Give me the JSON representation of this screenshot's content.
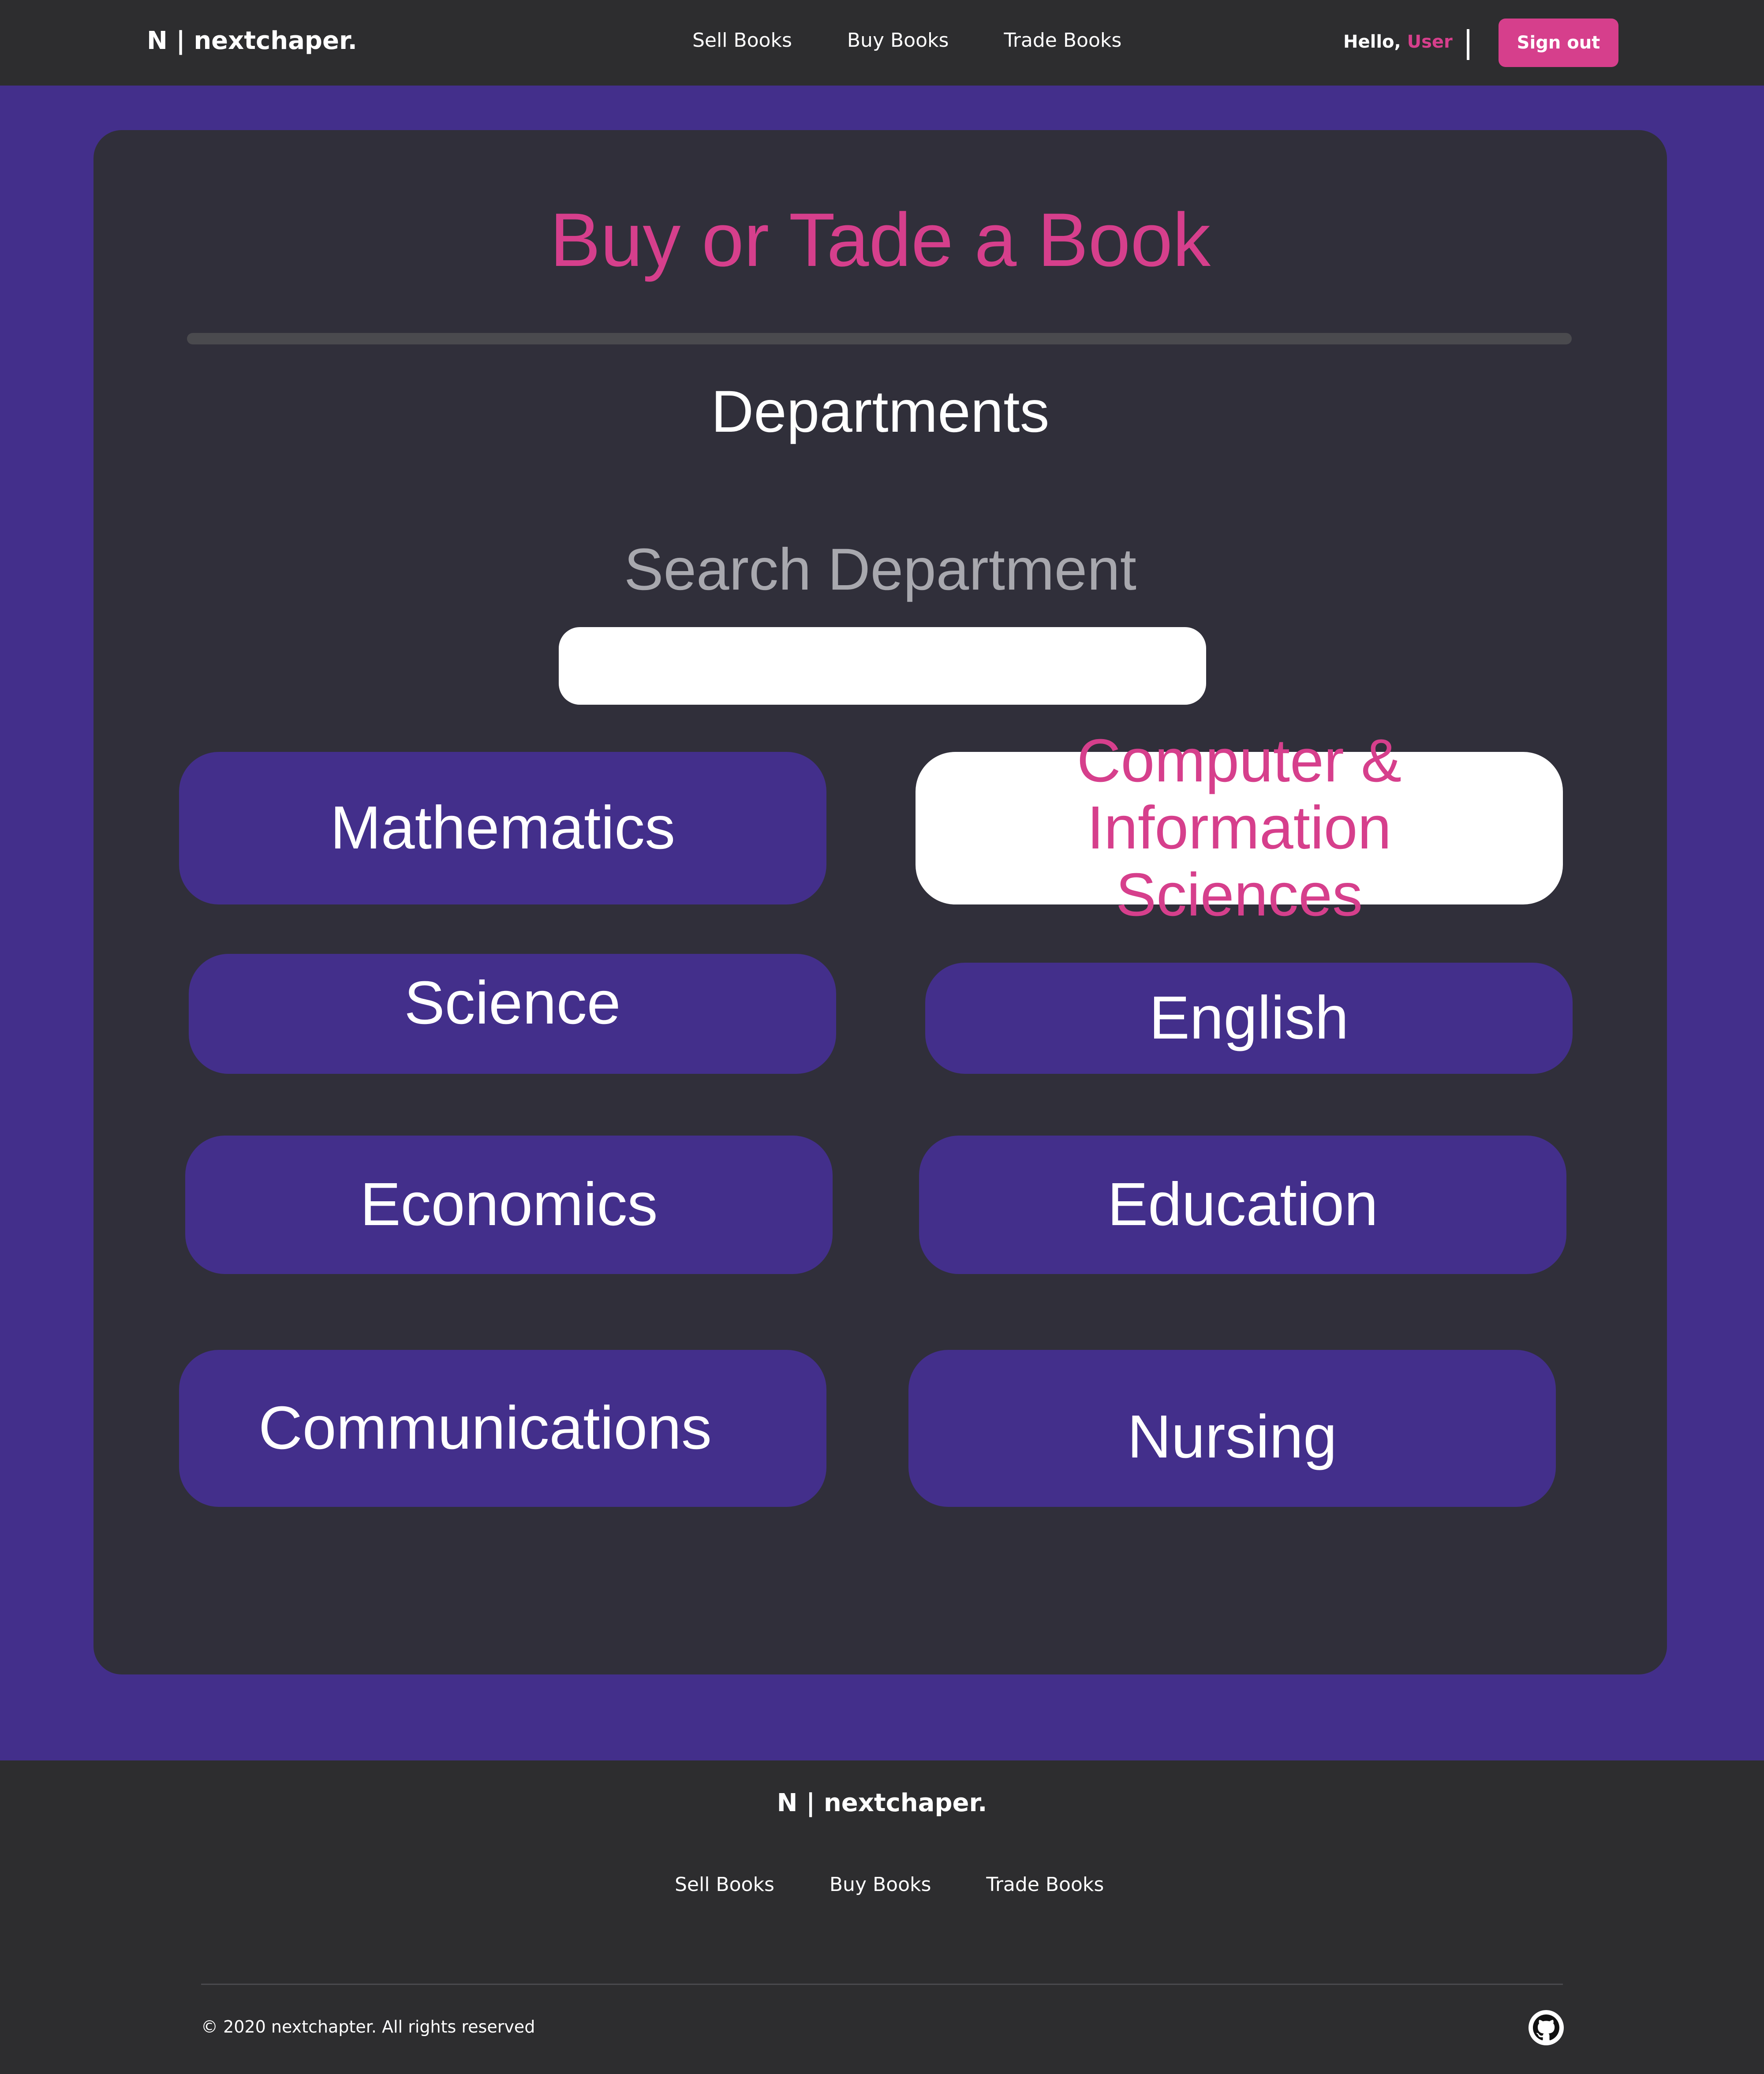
{
  "nav": {
    "brand": "N | nextchaper.",
    "links": [
      "Sell Books",
      "Buy Books",
      "Trade Books"
    ],
    "greeting": "Hello,",
    "user": "User",
    "signout": "Sign out"
  },
  "main": {
    "title": "Buy or Tade a Book",
    "departments_heading": "Departments",
    "search_label": "Search Department",
    "search_value": "",
    "departments": [
      "Mathematics",
      "Computer & Information Sciences",
      "Science",
      "English",
      "Economics",
      "Education",
      "Communications",
      "Nursing"
    ],
    "active_department": "Computer & Information Sciences"
  },
  "footer": {
    "brand": "N | nextchaper.",
    "links": [
      "Sell Books",
      "Buy Books",
      "Trade Books"
    ],
    "copyright": "© 2020 nextchapter. All rights reserved",
    "github_icon": "github-icon"
  },
  "colors": {
    "accent": "#D63F8C",
    "purple": "#432F8B",
    "card": "#302F3A",
    "nav": "#2D2D2F"
  }
}
